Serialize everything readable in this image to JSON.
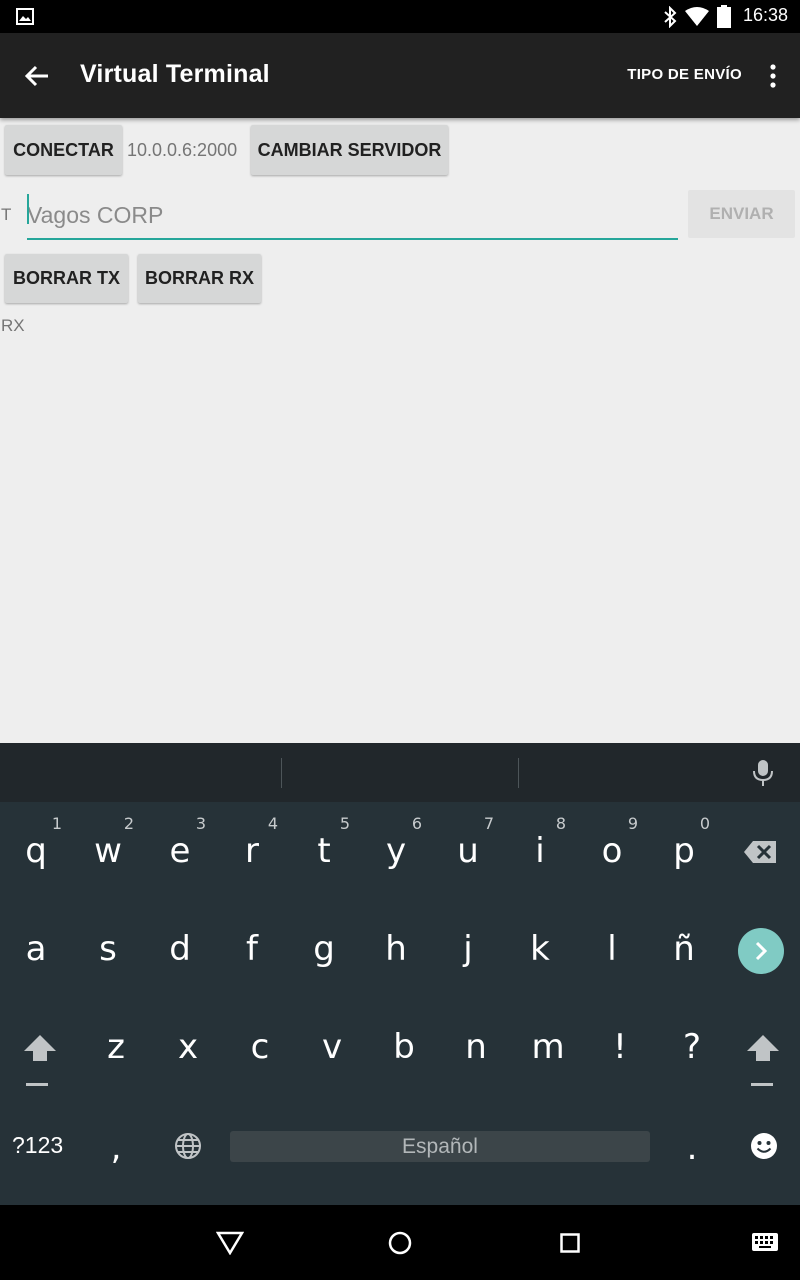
{
  "status_bar": {
    "time": "16:38"
  },
  "app_bar": {
    "title": "Virtual Terminal",
    "action": "TIPO DE ENVÍO"
  },
  "connection": {
    "connect_label": "CONECTAR",
    "server_address": "10.0.0.6:2000",
    "change_server_label": "CAMBIAR SERVIDOR"
  },
  "transmit": {
    "label": "T",
    "input_value": "",
    "input_placeholder": "Vagos CORP",
    "send_label": "ENVIAR"
  },
  "clear": {
    "clear_tx_label": "BORRAR TX",
    "clear_rx_label": "BORRAR RX"
  },
  "receive": {
    "label": "RX"
  },
  "keyboard": {
    "row1": [
      "q",
      "w",
      "e",
      "r",
      "t",
      "y",
      "u",
      "i",
      "o",
      "p"
    ],
    "row1_hints": [
      "1",
      "2",
      "3",
      "4",
      "5",
      "6",
      "7",
      "8",
      "9",
      "0"
    ],
    "row2": [
      "a",
      "s",
      "d",
      "f",
      "g",
      "h",
      "j",
      "k",
      "l",
      "ñ"
    ],
    "row3": [
      "z",
      "x",
      "c",
      "v",
      "b",
      "n",
      "m",
      "!",
      "?"
    ],
    "symbols_label": "?123",
    "comma": ",",
    "period": ".",
    "space_label": "Español",
    "accent_color": "#80cbc4"
  },
  "icons": [
    "image-icon",
    "bluetooth-icon",
    "wifi-icon",
    "battery-icon",
    "back-arrow-icon",
    "overflow-menu-icon",
    "microphone-icon",
    "backspace-icon",
    "enter-next-icon",
    "shift-icon",
    "globe-icon",
    "emoji-icon",
    "nav-back-icon",
    "nav-home-icon",
    "nav-recents-icon",
    "keyboard-switch-icon"
  ]
}
